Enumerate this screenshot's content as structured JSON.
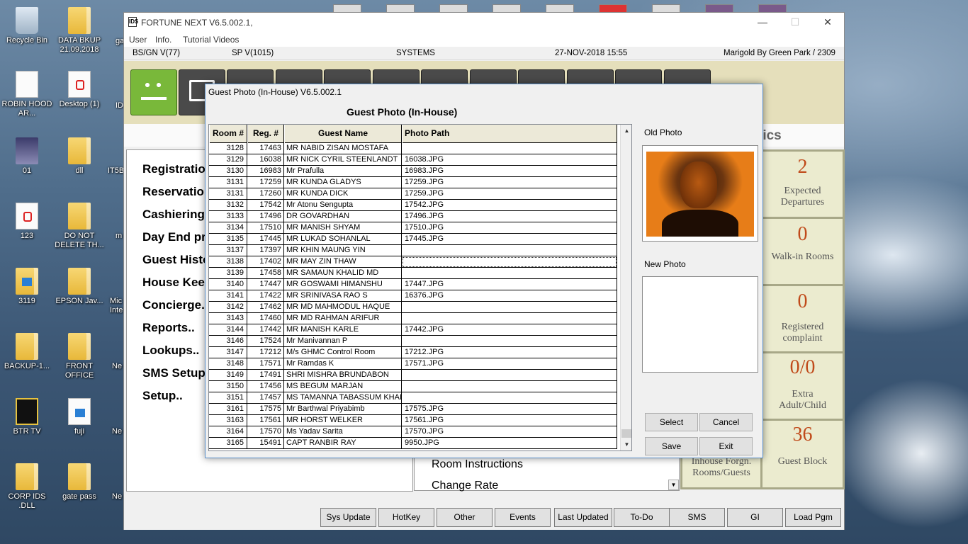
{
  "desktop": {
    "icons": [
      {
        "label": "Recycle Bin"
      },
      {
        "label": "DATA BKUP 21.09.2018"
      },
      {
        "label": "ROBIN HOOD AR..."
      },
      {
        "label": "Desktop (1)"
      },
      {
        "label": "01"
      },
      {
        "label": "dll"
      },
      {
        "label": "123"
      },
      {
        "label": "DO NOT DELETE TH..."
      },
      {
        "label": "3119"
      },
      {
        "label": "EPSON Jav..."
      },
      {
        "label": "BACKUP-1..."
      },
      {
        "label": "FRONT OFFICE"
      },
      {
        "label": "BTR TV"
      },
      {
        "label": "fuji"
      },
      {
        "label": "CORP IDS .DLL"
      },
      {
        "label": "gate pass"
      }
    ],
    "cut_labels": [
      "ga se",
      "ID",
      "IT5B",
      "m",
      "Mic Inte",
      "Ne",
      "Ne",
      "Ne"
    ]
  },
  "app": {
    "title": "FORTUNE NEXT  V6.5.002.1,",
    "logo": "IDS",
    "minimize": "—",
    "maximize": "☐",
    "close": "✕",
    "menu": [
      "User",
      "Info.",
      "Tutorial Videos"
    ],
    "status": {
      "bs": "BS/GN V(77)",
      "sp": "SP V(1015)",
      "module": "SYSTEMS",
      "datetime": "27-NOV-2018 15:55",
      "property": "Marigold By Green Park / 2309"
    },
    "stats_title": "tics",
    "left_menu": [
      "Registratio",
      "Reservatio",
      "Cashiering.",
      "Day End pr",
      "Guest Histo",
      "House Keep",
      "Concierge..",
      "Reports..",
      "Lookups..",
      "SMS Setup.",
      "Setup.."
    ],
    "lower_list": [
      "Room Instructions",
      "Change Rate"
    ],
    "stats": [
      {
        "value": "2",
        "label": "Expected Departures"
      },
      {
        "value": "0",
        "label": "Walk-in Rooms"
      },
      {
        "value": "0",
        "label": "Registered complaint"
      },
      {
        "value": "0/0",
        "label": "Extra Adult/Child"
      },
      {
        "value": "Inhouse Forgn. Rooms/Guests"
      },
      {
        "value": "36",
        "label": "Guest Block"
      }
    ],
    "bottom_buttons": [
      "Sys Update",
      "HotKey",
      "Other",
      "Events",
      "Last Updated",
      "To-Do",
      "SMS",
      "GI",
      "Load Pgm"
    ]
  },
  "dialog": {
    "title": "Guest Photo (In-House) V6.5.002.1",
    "heading": "Guest Photo (In-House)",
    "columns": [
      "Room #",
      "Reg. #",
      "Guest Name",
      "Photo Path"
    ],
    "rows": [
      {
        "room": "3128",
        "reg": "17463",
        "name": "MR NABID ZISAN MOSTAFA",
        "path": ""
      },
      {
        "room": "3129",
        "reg": "16038",
        "name": "MR NICK CYRIL STEENLANDT",
        "path": "16038.JPG"
      },
      {
        "room": "3130",
        "reg": "16983",
        "name": "Mr Prafulla",
        "path": "16983.JPG"
      },
      {
        "room": "3131",
        "reg": "17259",
        "name": "MR KUNDA GLADYS",
        "path": "17259.JPG"
      },
      {
        "room": "3131",
        "reg": "17260",
        "name": "MR KUNDA DICK",
        "path": "17259.JPG"
      },
      {
        "room": "3132",
        "reg": "17542",
        "name": "Mr Atonu   Sengupta",
        "path": "17542.JPG"
      },
      {
        "room": "3133",
        "reg": "17496",
        "name": "DR GOVARDHAN",
        "path": "17496.JPG"
      },
      {
        "room": "3134",
        "reg": "17510",
        "name": "MR MANISH SHYAM",
        "path": "17510.JPG"
      },
      {
        "room": "3135",
        "reg": "17445",
        "name": "MR LUKAD SOHANLAL",
        "path": "17445.JPG"
      },
      {
        "room": "3137",
        "reg": "17397",
        "name": "MR KHIN   MAUNG YIN",
        "path": ""
      },
      {
        "room": "3138",
        "reg": "17402",
        "name": "MR MAY   ZIN THAW",
        "path": ""
      },
      {
        "room": "3139",
        "reg": "17458",
        "name": "MR SAMAUN KHALID MD",
        "path": ""
      },
      {
        "room": "3140",
        "reg": "17447",
        "name": "MR GOSWAMI HIMANSHU",
        "path": "17447.JPG"
      },
      {
        "room": "3141",
        "reg": "17422",
        "name": "MR SRINIVASA RAO S",
        "path": "16376.JPG"
      },
      {
        "room": "3142",
        "reg": "17462",
        "name": "MR MD MAHMODUL HAQUE",
        "path": ""
      },
      {
        "room": "3143",
        "reg": "17460",
        "name": "MR MD RAHMAN ARIFUR",
        "path": ""
      },
      {
        "room": "3144",
        "reg": "17442",
        "name": "MR MANISH KARLE",
        "path": "17442.JPG"
      },
      {
        "room": "3146",
        "reg": "17524",
        "name": "Mr Manivannan   P",
        "path": ""
      },
      {
        "room": "3147",
        "reg": "17212",
        "name": "M/s GHMC Control Room",
        "path": "17212.JPG"
      },
      {
        "room": "3148",
        "reg": "17571",
        "name": "Mr Ramdas   K",
        "path": "17571.JPG"
      },
      {
        "room": "3149",
        "reg": "17491",
        "name": "SHRI MISHRA   BRUNDABON",
        "path": ""
      },
      {
        "room": "3150",
        "reg": "17456",
        "name": "MS BEGUM   MARJAN",
        "path": ""
      },
      {
        "room": "3151",
        "reg": "17457",
        "name": "MS TAMANNA TABASSUM KHAI",
        "path": ""
      },
      {
        "room": "3161",
        "reg": "17575",
        "name": "Mr Barthwal   Priyabimb",
        "path": "17575.JPG"
      },
      {
        "room": "3163",
        "reg": "17561",
        "name": "MR HORST WELKER",
        "path": "17561.JPG"
      },
      {
        "room": "3164",
        "reg": "17570",
        "name": "Ms Yadav   Sarita",
        "path": "17570.JPG"
      },
      {
        "room": "3165",
        "reg": "15491",
        "name": "CAPT RANBIR   RAY",
        "path": "9950.JPG"
      }
    ],
    "selected_room": "3138",
    "old_photo_label": "Old Photo",
    "new_photo_label": "New Photo",
    "buttons": {
      "select": "Select",
      "cancel": "Cancel",
      "save": "Save",
      "exit": "Exit"
    },
    "scroll_up": "▲",
    "scroll_down": "▼"
  }
}
